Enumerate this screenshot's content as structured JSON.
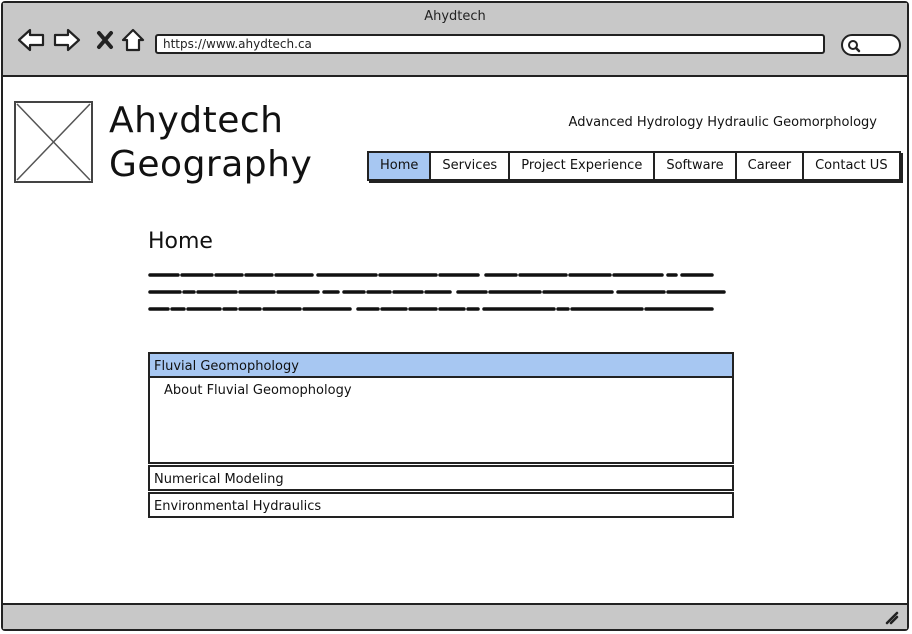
{
  "window": {
    "title": "Ahydtech"
  },
  "browser": {
    "url": "https://www.ahydtech.ca"
  },
  "icons": {
    "back": "back-arrow-icon",
    "forward": "forward-arrow-icon",
    "stop": "close-icon",
    "home": "home-icon",
    "search": "search-icon",
    "logo": "image-placeholder-icon",
    "resize": "resize-grip-icon"
  },
  "site": {
    "brand_line1": "Ahydtech",
    "brand_line2": "Geography",
    "tagline": "Advanced Hydrology Hydraulic Geomorphology"
  },
  "nav": {
    "items": [
      {
        "label": "Home",
        "active": true
      },
      {
        "label": "Services",
        "active": false
      },
      {
        "label": "Project Experience",
        "active": false
      },
      {
        "label": "Software",
        "active": false
      },
      {
        "label": "Career",
        "active": false
      },
      {
        "label": "Contact US",
        "active": false
      }
    ]
  },
  "main": {
    "heading": "Home",
    "accordion": [
      {
        "title": "Fluvial Geomophology",
        "open": true,
        "content": "About Fluvial Geomophology"
      },
      {
        "title": "Numerical Modeling",
        "open": false
      },
      {
        "title": "Environmental Hydraulics",
        "open": false
      }
    ]
  },
  "colors": {
    "chrome": "#c8c8c8",
    "accent": "#a7c7f2",
    "border": "#222222"
  }
}
